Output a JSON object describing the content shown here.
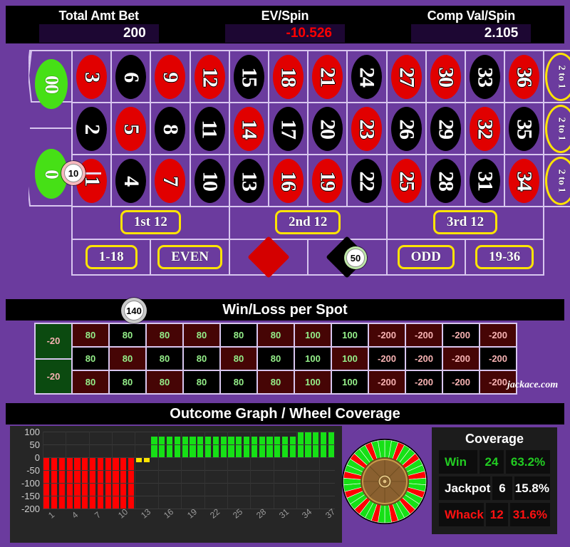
{
  "header": {
    "stats": [
      {
        "label": "Total Amt Bet",
        "value": "200",
        "negative": false
      },
      {
        "label": "EV/Spin",
        "value": "-10.526",
        "negative": true
      },
      {
        "label": "Comp Val/Spin",
        "value": "2.105",
        "negative": false
      }
    ]
  },
  "table": {
    "zeros": [
      {
        "label": "00",
        "name": "double-zero"
      },
      {
        "label": "0",
        "name": "zero"
      }
    ],
    "rows": [
      [
        {
          "n": "3",
          "c": "red"
        },
        {
          "n": "6",
          "c": "black"
        },
        {
          "n": "9",
          "c": "red"
        },
        {
          "n": "12",
          "c": "red"
        },
        {
          "n": "15",
          "c": "black"
        },
        {
          "n": "18",
          "c": "red"
        },
        {
          "n": "21",
          "c": "red"
        },
        {
          "n": "24",
          "c": "black"
        },
        {
          "n": "27",
          "c": "red"
        },
        {
          "n": "30",
          "c": "red"
        },
        {
          "n": "33",
          "c": "black"
        },
        {
          "n": "36",
          "c": "red"
        }
      ],
      [
        {
          "n": "2",
          "c": "black"
        },
        {
          "n": "5",
          "c": "red"
        },
        {
          "n": "8",
          "c": "black"
        },
        {
          "n": "11",
          "c": "black"
        },
        {
          "n": "14",
          "c": "red"
        },
        {
          "n": "17",
          "c": "black"
        },
        {
          "n": "20",
          "c": "black"
        },
        {
          "n": "23",
          "c": "red"
        },
        {
          "n": "26",
          "c": "black"
        },
        {
          "n": "29",
          "c": "black"
        },
        {
          "n": "32",
          "c": "red"
        },
        {
          "n": "35",
          "c": "black"
        }
      ],
      [
        {
          "n": "1",
          "c": "red"
        },
        {
          "n": "4",
          "c": "black"
        },
        {
          "n": "7",
          "c": "red"
        },
        {
          "n": "10",
          "c": "black"
        },
        {
          "n": "13",
          "c": "black"
        },
        {
          "n": "16",
          "c": "red"
        },
        {
          "n": "19",
          "c": "red"
        },
        {
          "n": "22",
          "c": "black"
        },
        {
          "n": "25",
          "c": "red"
        },
        {
          "n": "28",
          "c": "black"
        },
        {
          "n": "31",
          "c": "black"
        },
        {
          "n": "34",
          "c": "red"
        }
      ]
    ],
    "column_bets": [
      "2 to 1",
      "2 to 1",
      "2 to 1"
    ],
    "dozens": [
      "1st 12",
      "2nd 12",
      "3rd 12"
    ],
    "outside": [
      {
        "kind": "text",
        "label": "1-18"
      },
      {
        "kind": "text",
        "label": "EVEN"
      },
      {
        "kind": "diamond",
        "color": "red",
        "label": "red-diamond"
      },
      {
        "kind": "diamond",
        "color": "black",
        "label": "black-diamond"
      },
      {
        "kind": "text",
        "label": "ODD"
      },
      {
        "kind": "text",
        "label": "19-36"
      }
    ],
    "chips": [
      {
        "value": "10",
        "color": "#f6b8bd",
        "on": "zero-split"
      },
      {
        "value": "50",
        "color": "#bfe8a8",
        "on": "second-dozen-corner"
      },
      {
        "value": "140",
        "color": "#c9c9c9",
        "on": "low-1-18"
      }
    ]
  },
  "winloss": {
    "title": "Win/Loss per Spot",
    "zero_cells": [
      "-20",
      "-20"
    ],
    "columns": [
      {
        "values": [
          "80",
          "80",
          "80"
        ],
        "colors": [
          "red",
          "black",
          "red"
        ]
      },
      {
        "values": [
          "80",
          "80",
          "80"
        ],
        "colors": [
          "black",
          "red",
          "black"
        ]
      },
      {
        "values": [
          "80",
          "80",
          "80"
        ],
        "colors": [
          "red",
          "black",
          "red"
        ]
      },
      {
        "values": [
          "80",
          "80",
          "80"
        ],
        "colors": [
          "red",
          "black",
          "black"
        ]
      },
      {
        "values": [
          "80",
          "80",
          "80"
        ],
        "colors": [
          "black",
          "red",
          "black"
        ]
      },
      {
        "values": [
          "80",
          "80",
          "80"
        ],
        "colors": [
          "red",
          "black",
          "red"
        ]
      },
      {
        "values": [
          "100",
          "100",
          "100"
        ],
        "colors": [
          "red",
          "black",
          "red"
        ]
      },
      {
        "values": [
          "100",
          "100",
          "100"
        ],
        "colors": [
          "black",
          "red",
          "black"
        ]
      },
      {
        "values": [
          "-200",
          "-200",
          "-200"
        ],
        "colors": [
          "red",
          "black",
          "red"
        ]
      },
      {
        "values": [
          "-200",
          "-200",
          "-200"
        ],
        "colors": [
          "red",
          "black",
          "black"
        ]
      },
      {
        "values": [
          "-200",
          "-200",
          "-200"
        ],
        "colors": [
          "black",
          "red",
          "black"
        ]
      },
      {
        "values": [
          "-200",
          "-200",
          "-200"
        ],
        "colors": [
          "red",
          "black",
          "red"
        ]
      }
    ],
    "watermark": "jackace.com"
  },
  "outcome": {
    "title": "Outcome Graph / Wheel Coverage",
    "coverage": {
      "title": "Coverage",
      "rows": [
        {
          "name": "Win",
          "count": "24",
          "pct": "63.2%",
          "style": "cwin"
        },
        {
          "name": "Jackpot",
          "count": "6",
          "pct": "15.8%",
          "style": "cjack"
        },
        {
          "name": "Whack",
          "count": "12",
          "pct": "31.6%",
          "style": "cwhack"
        }
      ]
    }
  },
  "chart_data": {
    "type": "bar",
    "title": "Outcome Graph / Wheel Coverage",
    "xlabel": "",
    "ylabel": "",
    "ylim": [
      -200,
      100
    ],
    "yticks": [
      100,
      50,
      0,
      -50,
      -100,
      -150,
      -200
    ],
    "xticks": [
      "1",
      "4",
      "7",
      "10",
      "13",
      "16",
      "19",
      "22",
      "25",
      "28",
      "31",
      "34",
      "37"
    ],
    "grid": true,
    "legend": "none",
    "categories": [
      "1",
      "2",
      "3",
      "4",
      "5",
      "6",
      "7",
      "8",
      "9",
      "10",
      "11",
      "12",
      "13",
      "14",
      "15",
      "16",
      "17",
      "18",
      "19",
      "20",
      "21",
      "22",
      "23",
      "24",
      "25",
      "26",
      "27",
      "28",
      "29",
      "30",
      "31",
      "32",
      "33",
      "34",
      "35",
      "36",
      "37",
      "38"
    ],
    "values": [
      -200,
      -200,
      -200,
      -200,
      -200,
      -200,
      -200,
      -200,
      -200,
      -200,
      -200,
      -200,
      -20,
      -20,
      80,
      80,
      80,
      80,
      80,
      80,
      80,
      80,
      80,
      80,
      80,
      80,
      80,
      80,
      80,
      80,
      80,
      80,
      80,
      100,
      100,
      100,
      100,
      100
    ],
    "bar_colors": [
      "down",
      "down",
      "down",
      "down",
      "down",
      "down",
      "down",
      "down",
      "down",
      "down",
      "down",
      "down",
      "flat",
      "flat",
      "up",
      "up",
      "up",
      "up",
      "up",
      "up",
      "up",
      "up",
      "up",
      "up",
      "up",
      "up",
      "up",
      "up",
      "up",
      "up",
      "up",
      "up",
      "up",
      "up",
      "up",
      "up",
      "up",
      "up"
    ]
  },
  "wheel": {
    "name": "roulette-wheel",
    "segments": 38,
    "colors": {
      "win": "#16e016",
      "whack": "#ff0000",
      "hub": "#8a6030"
    }
  }
}
